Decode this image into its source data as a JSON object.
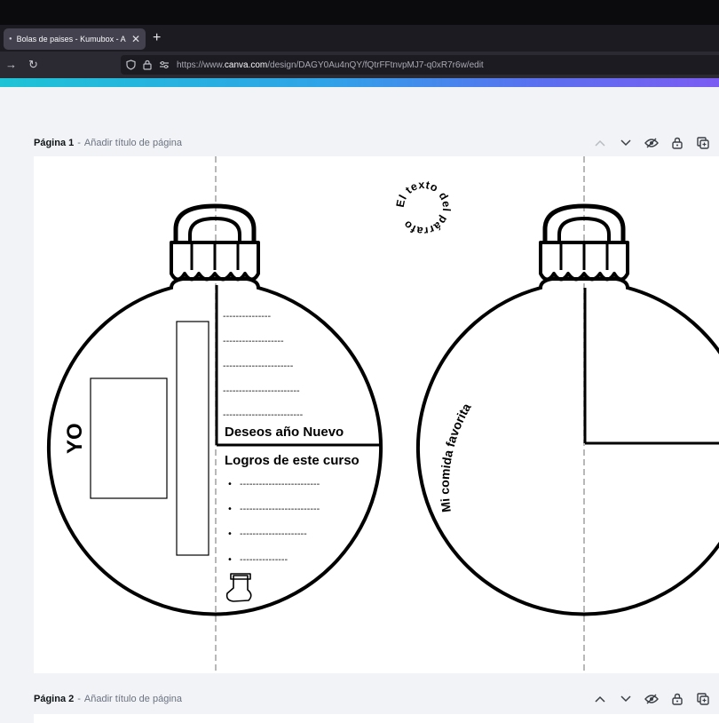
{
  "browser": {
    "tab_title": "Bolas de paises - Kumubox - A",
    "tab_close": "✕",
    "new_tab": "+",
    "url_prefix": "https://www.",
    "url_domain": "canva.com",
    "url_path": "/design/DAGY0Au4nQY/fQtrFFtnvpMJ7-q0xR7r6w/edit"
  },
  "pages": [
    {
      "title": "Página 1",
      "separator": " - ",
      "placeholder": "Añadir título de página"
    },
    {
      "title": "Página 2",
      "separator": " - ",
      "placeholder": "Añadir título de página"
    }
  ],
  "ornament_left": {
    "yo_label": "YO",
    "dash_lines": [
      "---------------",
      "-------------------",
      "----------------------",
      "------------------------",
      "-------------------------"
    ],
    "deseos_title": "Deseos año Nuevo",
    "logros_title": "Logros de este curso",
    "bullet": "•",
    "bullets": [
      "-------------------------",
      "-------------------------",
      "---------------------",
      "---------------"
    ]
  },
  "circular_text": "El texto del párrafo",
  "ornament_right": {
    "curved_label": "Mi comida favorita"
  }
}
